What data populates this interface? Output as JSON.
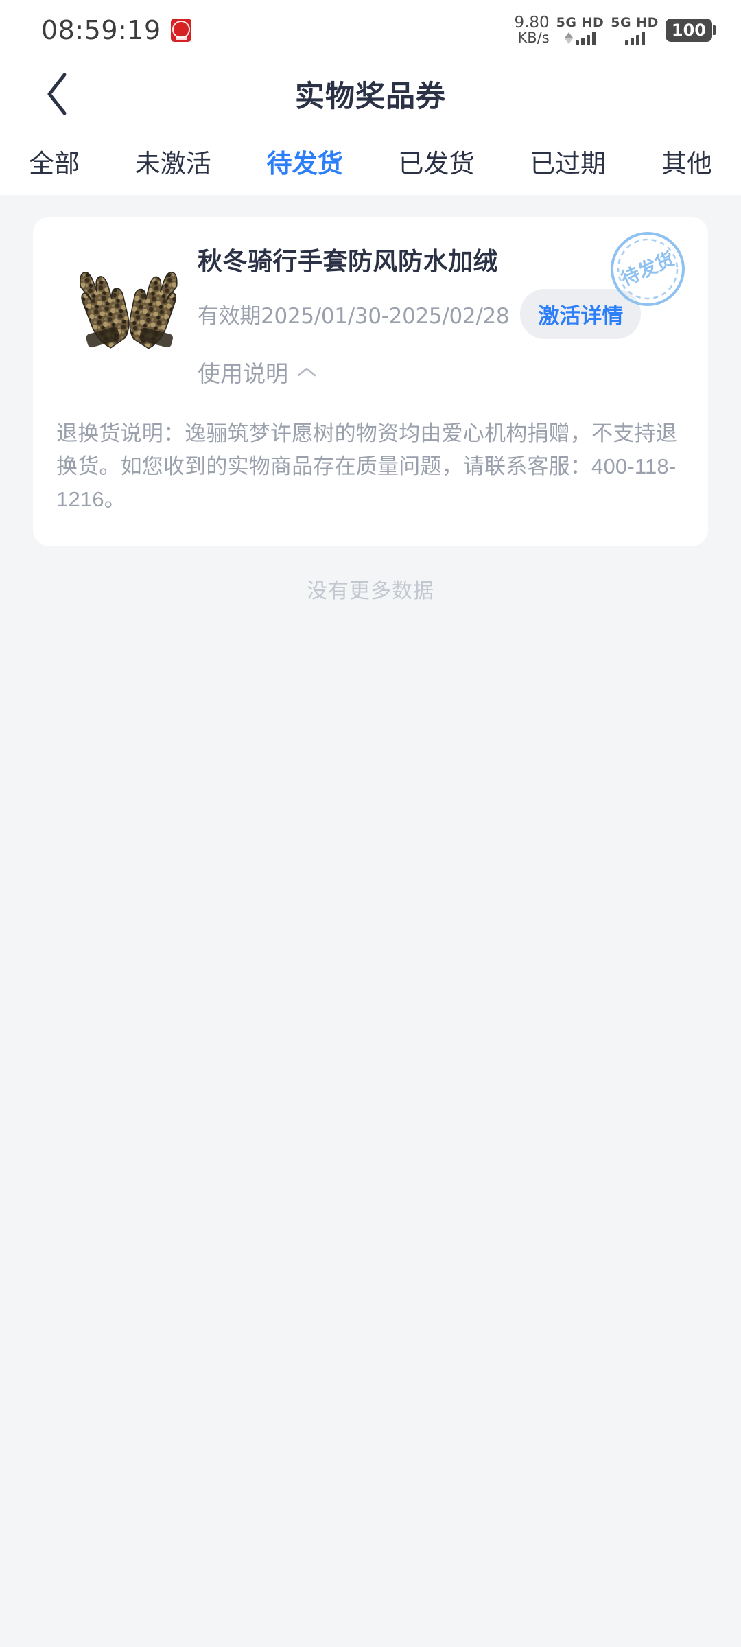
{
  "status_bar": {
    "time": "08:59:19",
    "app_icon": "red-badge-icon",
    "net_speed_value": "9.80",
    "net_speed_unit": "KB/s",
    "sim1_label": "5G HD",
    "sim2_label": "5G HD",
    "battery": "100"
  },
  "nav": {
    "back_icon": "chevron-left-icon",
    "title": "实物奖品券"
  },
  "tabs": [
    {
      "label": "全部",
      "active": false
    },
    {
      "label": "未激活",
      "active": false
    },
    {
      "label": "待发货",
      "active": true
    },
    {
      "label": "已发货",
      "active": false
    },
    {
      "label": "已过期",
      "active": false
    },
    {
      "label": "其他",
      "active": false
    }
  ],
  "card": {
    "product_image": "camouflage-gloves-image",
    "title": "秋冬骑行手套防风防水加绒",
    "validity": "有效期2025/01/30-2025/02/28",
    "detail_button": "激活详情",
    "usage_label": "使用说明",
    "usage_chevron": "chevron-up-icon",
    "stamp_text": "待发货",
    "description": "退换货说明：逸骊筑梦许愿树的物资均由爱心机构捐赠，不支持退换货。如您收到的实物商品存在质量问题，请联系客服：400-118-1216。"
  },
  "footer": {
    "no_more": "没有更多数据"
  },
  "colors": {
    "accent": "#2d7ff9",
    "title": "#2b3245",
    "muted": "#9aa0ac",
    "page_bg": "#f4f5f7",
    "card_bg": "#ffffff",
    "stamp": "#8fc2f0"
  }
}
